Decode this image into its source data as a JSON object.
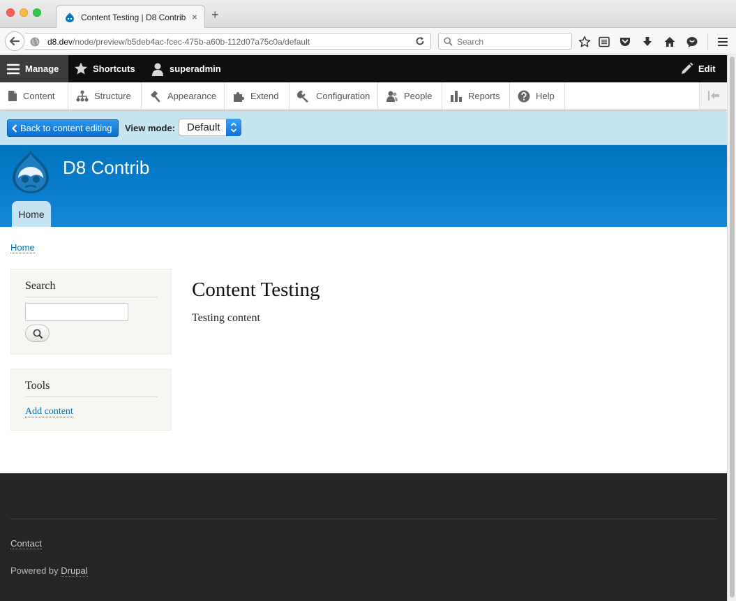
{
  "browser": {
    "tab_title": "Content Testing | D8 Contrib",
    "tab_close": "×",
    "new_tab": "+",
    "url_host": "d8.dev",
    "url_path": "/node/preview/b5deb4ac-fcec-475b-a60b-112d07a75c0a/default",
    "search_placeholder": "Search",
    "toolbar_icons": [
      "star-icon",
      "reading-list-icon",
      "pocket-icon",
      "download-icon",
      "home-icon",
      "chat-icon",
      "menu-icon"
    ]
  },
  "admin_toolbar": {
    "manage": "Manage",
    "shortcuts": "Shortcuts",
    "user": "superadmin",
    "edit": "Edit"
  },
  "admin_tray": {
    "items": [
      "Content",
      "Structure",
      "Appearance",
      "Extend",
      "Configuration",
      "People",
      "Reports",
      "Help"
    ]
  },
  "preview_bar": {
    "back_label": "Back to content editing",
    "view_mode_label": "View mode:",
    "view_mode_value": "Default"
  },
  "site": {
    "name": "D8 Contrib",
    "nav_home": "Home"
  },
  "breadcrumb": {
    "home": "Home"
  },
  "sidebar": {
    "search_title": "Search",
    "tools_title": "Tools",
    "add_content": "Add content"
  },
  "main": {
    "title": "Content Testing",
    "body": "Testing content"
  },
  "footer": {
    "contact": "Contact",
    "powered_prefix": "Powered by",
    "drupal": "Drupal"
  },
  "colors": {
    "header_blue": "#0074bd",
    "preview_bg": "#c6e5f2",
    "link": "#0071b3",
    "footer_bg": "#252525",
    "admin_bar": "#0f0f0f"
  }
}
